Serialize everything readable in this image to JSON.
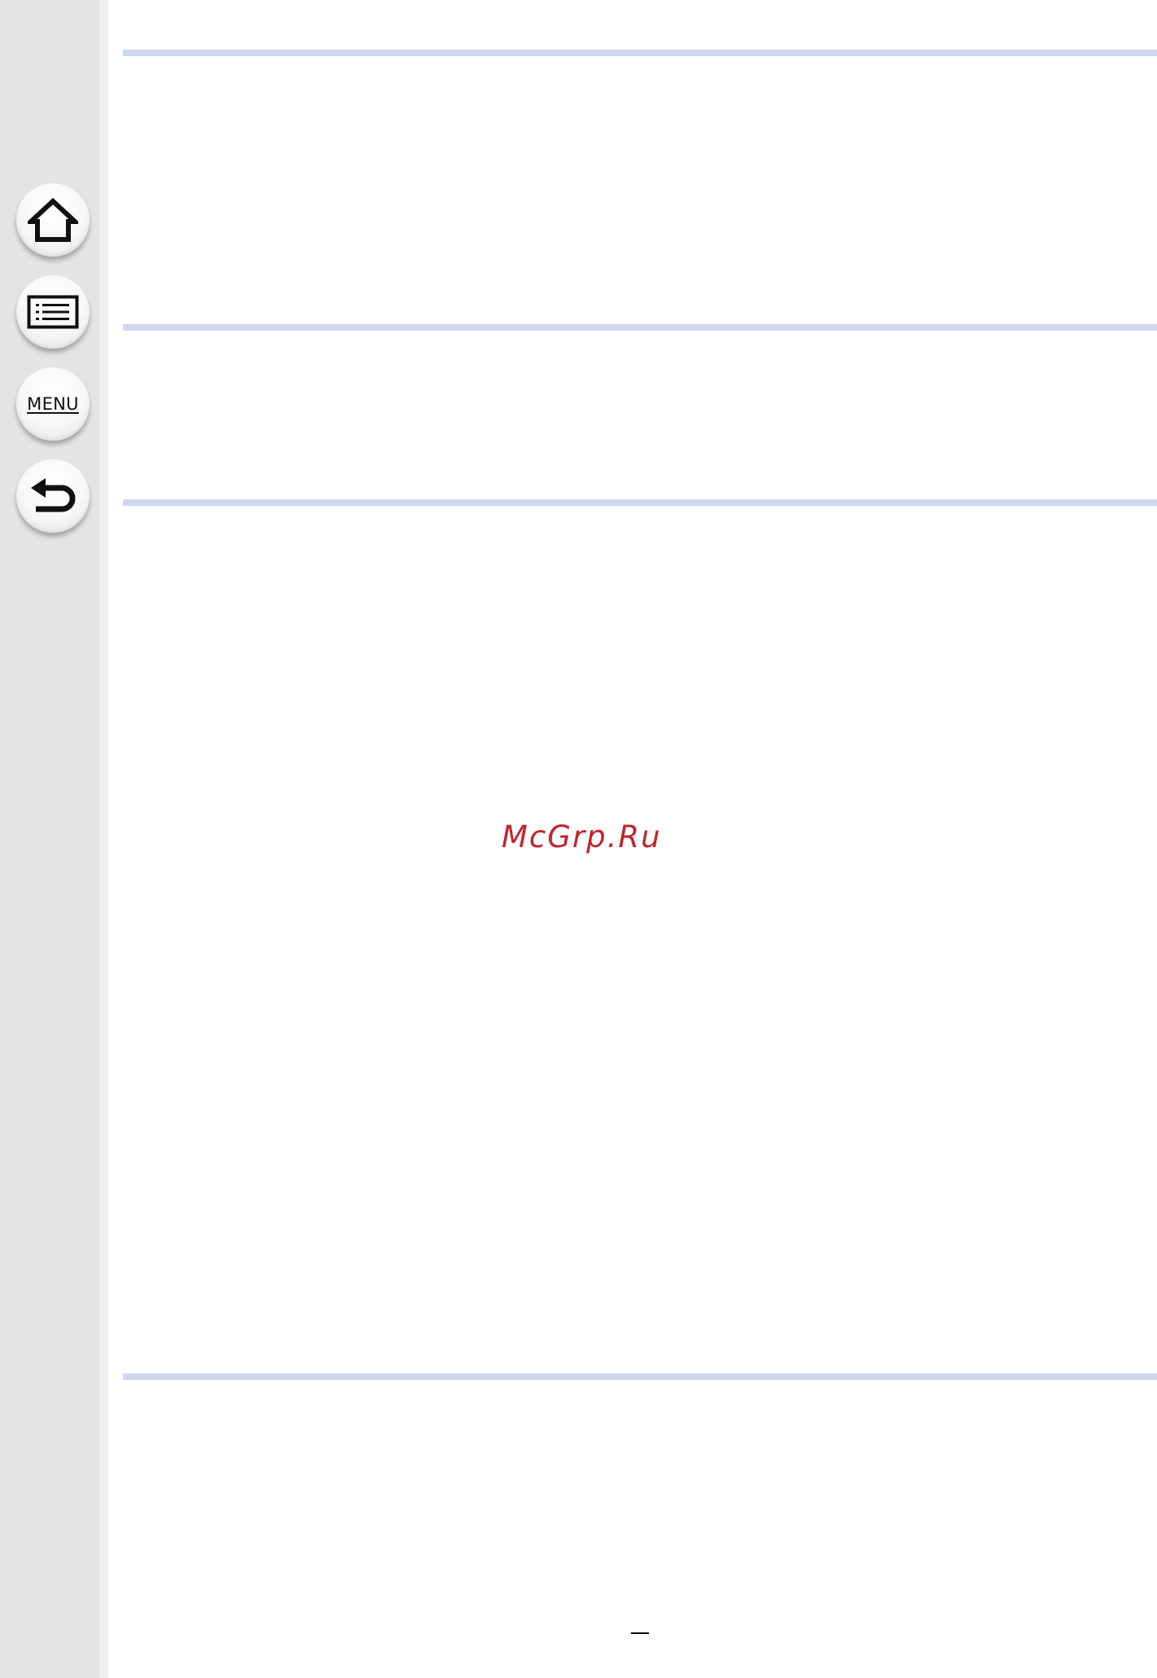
{
  "sidebar": {
    "home_button": {
      "icon": "home-icon"
    },
    "contents_button": {
      "icon": "list-icon"
    },
    "menu_button": {
      "label": "MENU"
    },
    "back_button": {
      "icon": "back-arrow-icon"
    }
  },
  "watermark": {
    "text": "McGrp.Ru",
    "color": "#c0242b"
  },
  "colors": {
    "sidebar": "#e4e4e4",
    "rule": "#cdd7f0"
  }
}
